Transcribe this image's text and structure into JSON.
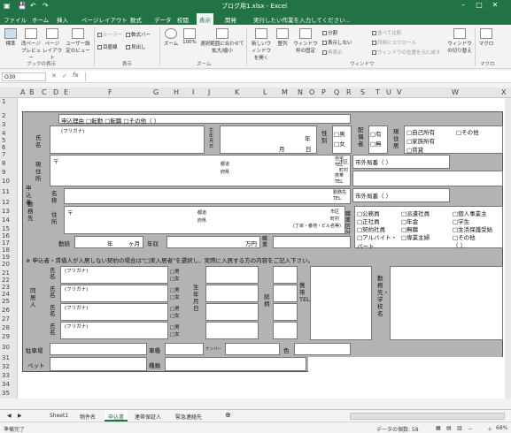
{
  "window": {
    "title": "ブログ用1.xlsx - Excel",
    "help_prompt": "実行したい作業を入力してください..."
  },
  "menu": [
    "ファイル",
    "ホーム",
    "挿入",
    "ページレイアウト",
    "数式",
    "データ",
    "校閲",
    "表示",
    "開発"
  ],
  "ribbon": {
    "groups": {
      "book_view": "ブックの表示",
      "show": "表示",
      "zoom": "ズーム",
      "window": "ウィンドウ",
      "macro": "マクロ"
    },
    "buttons": {
      "normal": "標準",
      "page_break": "改ページ プレビュー",
      "page_layout": "ページ レイアウト",
      "custom_view": "ユーザー設定のビュー",
      "zoom": "ズーム",
      "zoom100": "100%",
      "zoom_sel": "選択範囲に合わせて拡大/縮小",
      "new_window": "新しいウィンドウを開く",
      "arrange": "整列",
      "freeze": "ウィンドウ枠の固定",
      "switch_window": "ウィンドウの切り替え",
      "macro": "マクロ"
    },
    "checks": {
      "ruler": "ルーラー",
      "formula_bar": "数式バー",
      "gridlines": "目盛線",
      "headings": "見出し",
      "split": "分割",
      "hide": "表示しない",
      "unhide": "再表示",
      "side_by_side": "並べて比較",
      "sync_scroll": "同時にスクロール",
      "reset_pos": "ウィンドウの位置を元に戻す"
    }
  },
  "formula_bar": {
    "name_box": "O30"
  },
  "columns": [
    "A",
    "B",
    "C",
    "D",
    "E",
    "F",
    "G",
    "H",
    "I",
    "J",
    "K",
    "L",
    "M",
    "N",
    "O",
    "P",
    "Q",
    "R",
    "S",
    "T",
    "U",
    "V",
    "W",
    "X"
  ],
  "rows": [
    "1",
    "2",
    "3",
    "4",
    "5",
    "6",
    "7",
    "8",
    "9",
    "10",
    "11",
    "12",
    "13",
    "14",
    "15",
    "16",
    "17",
    "18",
    "19",
    "20",
    "21",
    "22",
    "23",
    "24",
    "25",
    "26",
    "27",
    "28",
    "29",
    "30",
    "31",
    "32",
    "33",
    "34",
    "35"
  ],
  "form": {
    "reason": "申込理由 □転勤 □転職 □その他（                                  ）",
    "applicant": "申込者",
    "name": "氏名",
    "furigana": "(フリガナ)",
    "birth": "生年月日",
    "year": "年",
    "month": "月",
    "day": "日",
    "gender": "性別",
    "male": "□男",
    "female": "□女",
    "spouse": "配偶者",
    "has": "□有",
    "none": "□無",
    "current": "現住居",
    "own": "□自己所有",
    "family": "□家族所有",
    "rent": "□賃貸",
    "other": "□その他",
    "address": "現住所",
    "postal": "〒",
    "pref": "都道",
    "fu": "府県",
    "city": "市区",
    "town": "町村",
    "home_tel": "自宅TEL",
    "mobile_tel": "携帯TEL",
    "work_tel": "勤務先TEL",
    "area_code": "市外局番（    ）",
    "workplace": "勤務先",
    "wname": "名称",
    "waddr": "住所",
    "building": "(丁目・番地・ビル名等)",
    "job_type": "職業区分",
    "jobs": [
      "□公務員",
      "□派遣社員",
      "□個人事業主",
      "□正社員",
      "□年金",
      "□学生",
      "□契約社員",
      "□無職",
      "□生活保護受給",
      "□アルバイト・パート",
      "□専業主婦",
      "□その他"
    ],
    "job_paren": "（          ）",
    "tenure": "勤続",
    "tyear": "年",
    "tmonth": "ヶ月",
    "income": "年収",
    "yen": "万円",
    "occupation": "職業",
    "note": "※ 申込者・賃借人が入居しない契約の場合は\"□実入居者\"を選択し、実際に入居する方の内容をご記入下さい。",
    "residents": "同居人",
    "relation": "続柄",
    "mobile": "携帯TEL",
    "school": "勤務先・学校名",
    "parking": "駐車場",
    "car_type": "車種",
    "number": "ナンバー",
    "color": "色",
    "pet": "ペット",
    "kind": "種類"
  },
  "sheet_tabs": [
    "Sheet1",
    "物件名",
    "申込書",
    "連帯保証人",
    "緊急連絡先"
  ],
  "active_tab": "申込書",
  "status": {
    "ready": "準備完了",
    "count": "データの個数: 58",
    "zoom": "68%"
  }
}
